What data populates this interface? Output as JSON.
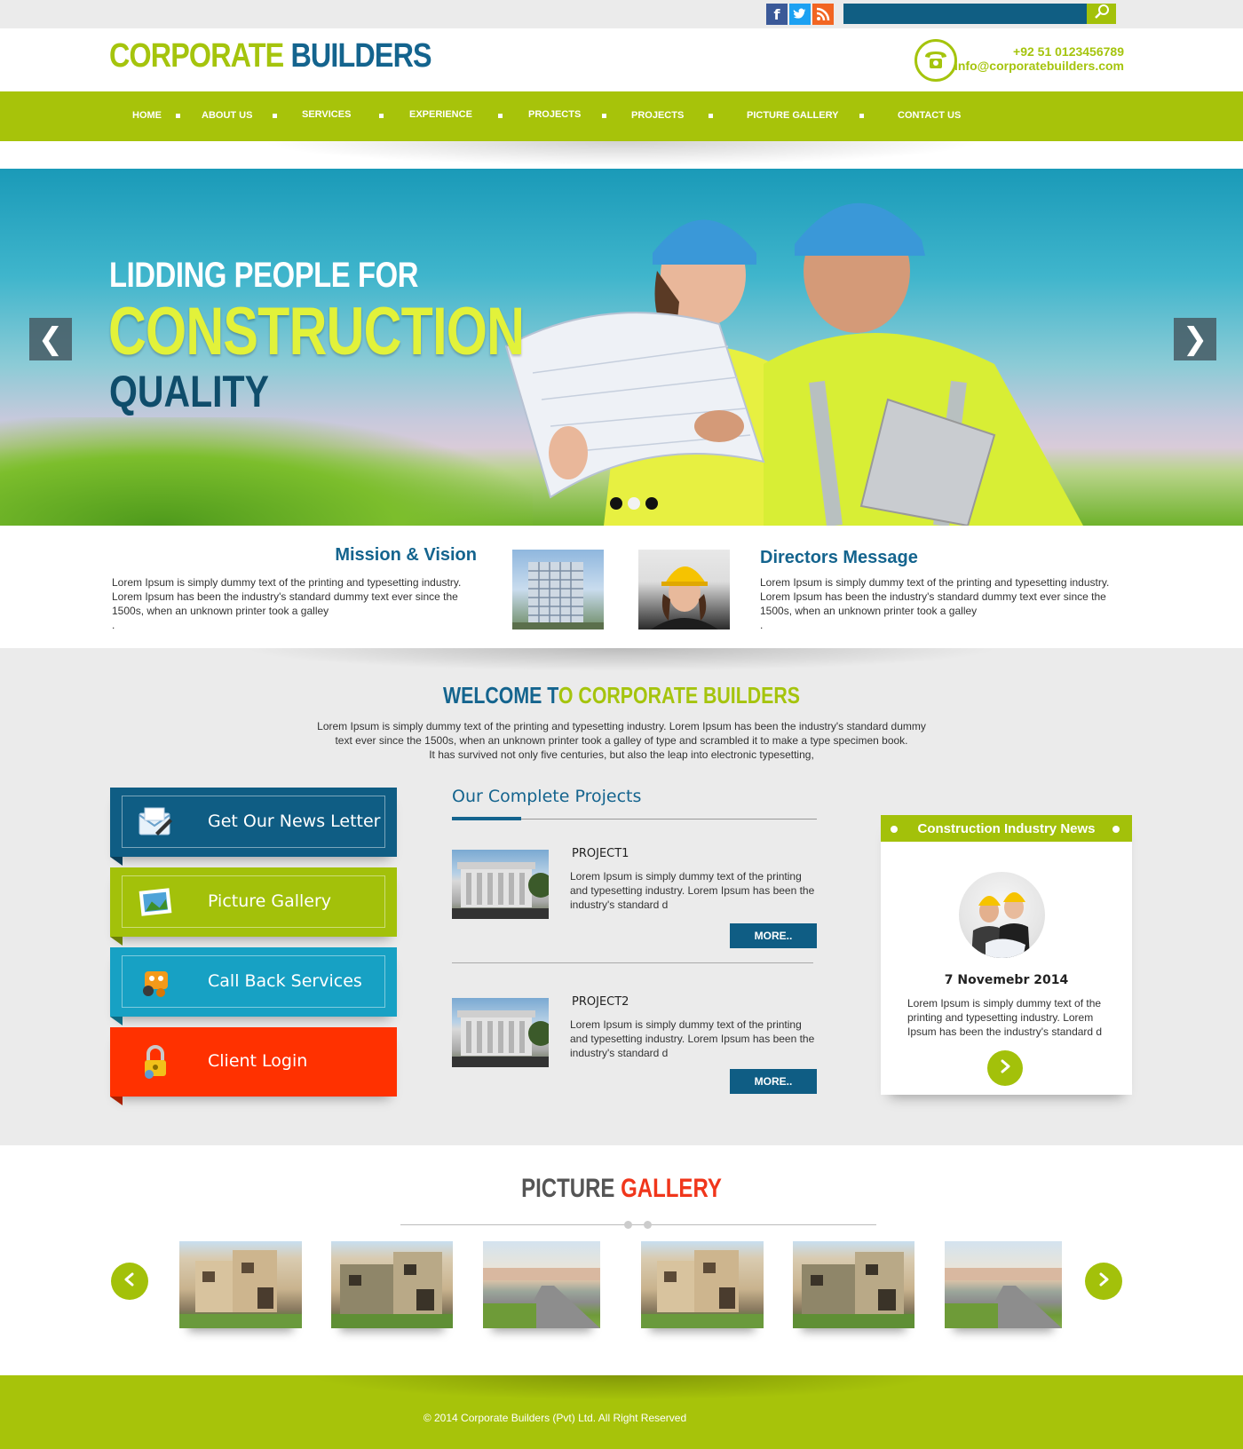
{
  "top": {
    "search_placeholder": ""
  },
  "logo": {
    "part1": "CORPORATE",
    "part2": "BUILDERS"
  },
  "contact": {
    "phone": "+92 51 0123456789",
    "email": "info@corporatebuilders.com"
  },
  "nav": {
    "items": [
      "HOME",
      "ABOUT US",
      "SERVICES",
      "EXPERIENCE",
      "PROJECTS",
      "PROJECTS",
      "PICTURE GALLERY",
      "CONTACT US"
    ]
  },
  "hero": {
    "line1": "LIDDING PEOPLE FOR",
    "line2": "CONSTRUCTION",
    "line3": "QUALITY",
    "prev": "❮",
    "next": "❯",
    "dots": [
      {
        "color": "#111111"
      },
      {
        "color": "#f2f2f2"
      },
      {
        "color": "#111111"
      }
    ]
  },
  "mission": {
    "title": "Mission & Vision",
    "text": "Lorem Ipsum is simply dummy text of the printing and typesetting industry. Lorem Ipsum has been the industry's standard dummy text ever since the 1500s, when an unknown printer took a galley",
    "trailing": "."
  },
  "director": {
    "title": "Directors Message",
    "text": "Lorem Ipsum is simply dummy text of the printing and typesetting industry. Lorem Ipsum has been the industry's standard dummy text ever since the 1500s, when an unknown printer took a galley",
    "trailing": "."
  },
  "welcome": {
    "title_part1": "WELCOME T",
    "title_part2": "O CORPORATE BUILDERS",
    "line1": "Lorem Ipsum is simply dummy text of the printing and typesetting industry. Lorem Ipsum has been the industry's standard dummy",
    "line2": "text ever since the 1500s, when an unknown printer took a galley of type and scrambled it to make a type specimen book.",
    "line3": "It has survived not only five centuries, but also the leap into electronic typesetting,"
  },
  "side_buttons": {
    "newsletter": "Get Our News Letter",
    "gallery": "Picture Gallery",
    "callback": "Call Back Services",
    "login": "Client Login"
  },
  "projects": {
    "title": "Our Complete Projects",
    "items": [
      {
        "title": "PROJECT1",
        "text": "Lorem Ipsum is simply dummy text of the printing and typesetting industry. Lorem Ipsum has been the industry's standard d",
        "more": "MORE.."
      },
      {
        "title": "PROJECT2",
        "text": "Lorem Ipsum is simply dummy text of the printing and typesetting industry. Lorem Ipsum has been the industry's standard d",
        "more": "MORE.."
      }
    ]
  },
  "news": {
    "title": "Construction Industry News",
    "date": "7 Novemebr 2014",
    "text": "Lorem Ipsum is simply dummy text of the printing and typesetting industry. Lorem Ipsum has been the industry's standard d"
  },
  "gallery": {
    "title_part1": "PICTURE",
    "title_part2": "GALLERY",
    "images": [
      "house-photo",
      "house-photo",
      "street-photo",
      "house-photo",
      "house-photo",
      "street-photo"
    ]
  },
  "footer": {
    "copyright": "© 2014 Corporate Builders (Pvt) Ltd. All Right Reserved"
  },
  "colors": {
    "brand_green": "#a7c30a",
    "brand_blue": "#14648e",
    "accent_red": "#ff3100",
    "accent_cyan": "#17a1c4"
  }
}
